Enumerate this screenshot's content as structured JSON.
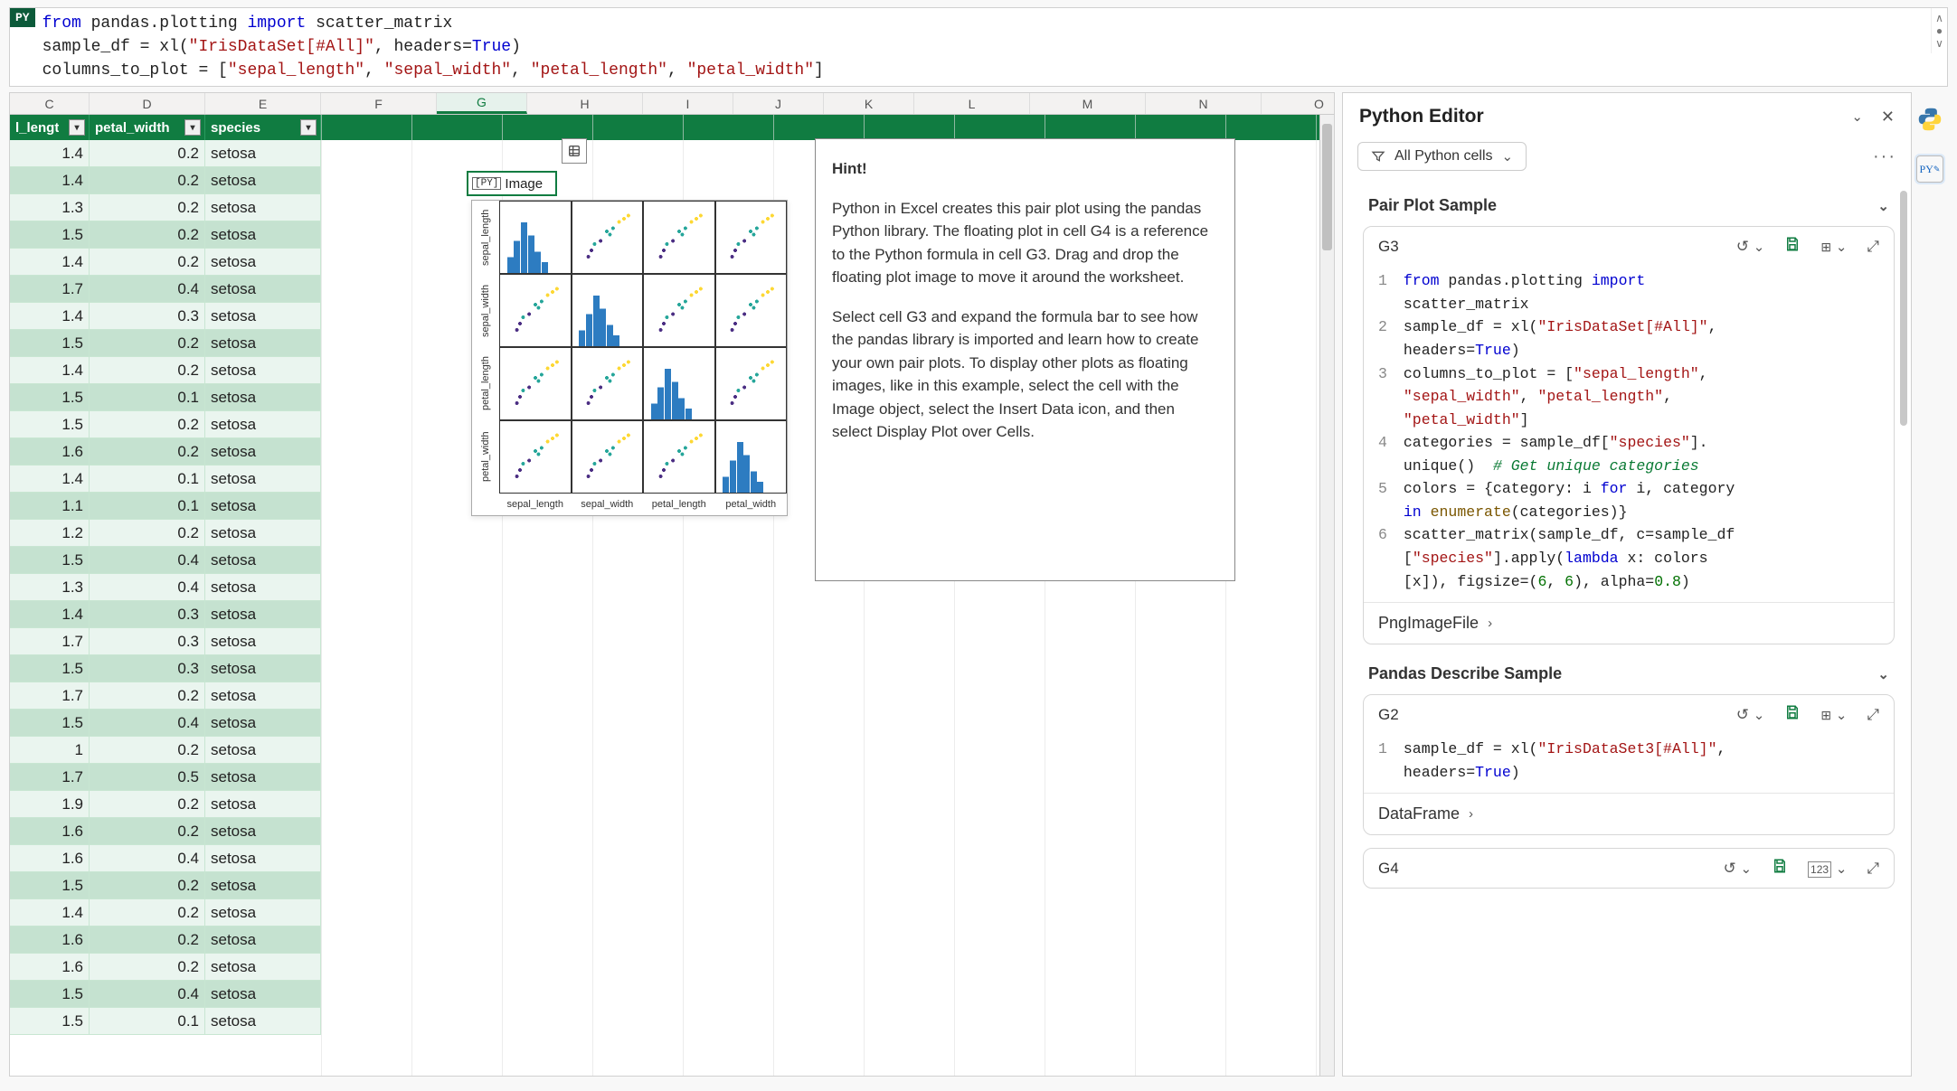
{
  "formula_bar": {
    "badge": "PY",
    "lines": [
      [
        {
          "t": "from ",
          "c": "kw-blue"
        },
        {
          "t": "pandas.plotting ",
          "c": ""
        },
        {
          "t": "import ",
          "c": "kw-blue"
        },
        {
          "t": "scatter_matrix",
          "c": ""
        }
      ],
      [
        {
          "t": "sample_df = xl(",
          "c": ""
        },
        {
          "t": "\"IrisDataSet[#All]\"",
          "c": "kw-str"
        },
        {
          "t": ", headers=",
          "c": ""
        },
        {
          "t": "True",
          "c": "kw-bool"
        },
        {
          "t": ")",
          "c": ""
        }
      ],
      [
        {
          "t": "columns_to_plot = [",
          "c": ""
        },
        {
          "t": "\"sepal_length\"",
          "c": "kw-str"
        },
        {
          "t": ", ",
          "c": ""
        },
        {
          "t": "\"sepal_width\"",
          "c": "kw-str"
        },
        {
          "t": ", ",
          "c": ""
        },
        {
          "t": "\"petal_length\"",
          "c": "kw-str"
        },
        {
          "t": ", ",
          "c": ""
        },
        {
          "t": "\"petal_width\"",
          "c": "kw-str"
        },
        {
          "t": "]",
          "c": ""
        }
      ]
    ]
  },
  "columns": [
    "C",
    "D",
    "E",
    "F",
    "G",
    "H",
    "I",
    "J",
    "K",
    "L",
    "M",
    "N",
    "O"
  ],
  "selected_col": "G",
  "filter_headers": [
    {
      "label": "l_lengt",
      "w": "fc-C"
    },
    {
      "label": "petal_width",
      "w": "fc-D"
    },
    {
      "label": "species",
      "w": "fc-E"
    }
  ],
  "rows": [
    {
      "c": "1.4",
      "d": "0.2",
      "e": "setosa"
    },
    {
      "c": "1.4",
      "d": "0.2",
      "e": "setosa"
    },
    {
      "c": "1.3",
      "d": "0.2",
      "e": "setosa"
    },
    {
      "c": "1.5",
      "d": "0.2",
      "e": "setosa"
    },
    {
      "c": "1.4",
      "d": "0.2",
      "e": "setosa"
    },
    {
      "c": "1.7",
      "d": "0.4",
      "e": "setosa"
    },
    {
      "c": "1.4",
      "d": "0.3",
      "e": "setosa"
    },
    {
      "c": "1.5",
      "d": "0.2",
      "e": "setosa"
    },
    {
      "c": "1.4",
      "d": "0.2",
      "e": "setosa"
    },
    {
      "c": "1.5",
      "d": "0.1",
      "e": "setosa"
    },
    {
      "c": "1.5",
      "d": "0.2",
      "e": "setosa"
    },
    {
      "c": "1.6",
      "d": "0.2",
      "e": "setosa"
    },
    {
      "c": "1.4",
      "d": "0.1",
      "e": "setosa"
    },
    {
      "c": "1.1",
      "d": "0.1",
      "e": "setosa"
    },
    {
      "c": "1.2",
      "d": "0.2",
      "e": "setosa"
    },
    {
      "c": "1.5",
      "d": "0.4",
      "e": "setosa"
    },
    {
      "c": "1.3",
      "d": "0.4",
      "e": "setosa"
    },
    {
      "c": "1.4",
      "d": "0.3",
      "e": "setosa"
    },
    {
      "c": "1.7",
      "d": "0.3",
      "e": "setosa"
    },
    {
      "c": "1.5",
      "d": "0.3",
      "e": "setosa"
    },
    {
      "c": "1.7",
      "d": "0.2",
      "e": "setosa"
    },
    {
      "c": "1.5",
      "d": "0.4",
      "e": "setosa"
    },
    {
      "c": "1",
      "d": "0.2",
      "e": "setosa"
    },
    {
      "c": "1.7",
      "d": "0.5",
      "e": "setosa"
    },
    {
      "c": "1.9",
      "d": "0.2",
      "e": "setosa"
    },
    {
      "c": "1.6",
      "d": "0.2",
      "e": "setosa"
    },
    {
      "c": "1.6",
      "d": "0.4",
      "e": "setosa"
    },
    {
      "c": "1.5",
      "d": "0.2",
      "e": "setosa"
    },
    {
      "c": "1.4",
      "d": "0.2",
      "e": "setosa"
    },
    {
      "c": "1.6",
      "d": "0.2",
      "e": "setosa"
    },
    {
      "c": "1.6",
      "d": "0.2",
      "e": "setosa"
    },
    {
      "c": "1.5",
      "d": "0.4",
      "e": "setosa"
    },
    {
      "c": "1.5",
      "d": "0.1",
      "e": "setosa"
    }
  ],
  "selected_cell": {
    "badge": "[PY]",
    "label": "Image"
  },
  "plot": {
    "labels": [
      "sepal_length",
      "sepal_width",
      "petal_length",
      "petal_width"
    ]
  },
  "hint": {
    "title": "Hint!",
    "p1": "Python in Excel creates this pair plot using the pandas Python library. The floating plot in cell G4 is a reference to the Python formula in cell G3. Drag and drop the floating plot image to move it around the worksheet.",
    "p2": "Select cell G3 and expand the formula bar to see how the pandas library is imported and learn how to create your own pair plots. To display other plots as floating images, like in this example, select the cell with the Image object, select the Insert Data icon, and then select Display Plot over Cells."
  },
  "editor": {
    "title": "Python Editor",
    "filter": "All Python cells",
    "sections": [
      {
        "title": "Pair Plot Sample",
        "cell": "G3",
        "foot": "PngImageFile",
        "lines": [
          [
            {
              "t": "from ",
              "c": "kw-blue"
            },
            {
              "t": "pandas.plotting ",
              "c": ""
            },
            {
              "t": "import",
              "c": "kw-blue"
            },
            {
              "t": "\nscatter_matrix",
              "c": ""
            }
          ],
          [
            {
              "t": "sample_df = xl(",
              "c": ""
            },
            {
              "t": "\"IrisDataSet[#All]\"",
              "c": "kw-str"
            },
            {
              "t": ",\nheaders=",
              "c": ""
            },
            {
              "t": "True",
              "c": "kw-bool"
            },
            {
              "t": ")",
              "c": ""
            }
          ],
          [
            {
              "t": "columns_to_plot = [",
              "c": ""
            },
            {
              "t": "\"sepal_length\"",
              "c": "kw-str"
            },
            {
              "t": ",\n",
              "c": ""
            },
            {
              "t": "\"sepal_width\"",
              "c": "kw-str"
            },
            {
              "t": ", ",
              "c": ""
            },
            {
              "t": "\"petal_length\"",
              "c": "kw-str"
            },
            {
              "t": ",\n",
              "c": ""
            },
            {
              "t": "\"petal_width\"",
              "c": "kw-str"
            },
            {
              "t": "]",
              "c": ""
            }
          ],
          [
            {
              "t": "categories = sample_df[",
              "c": ""
            },
            {
              "t": "\"species\"",
              "c": "kw-str"
            },
            {
              "t": "].\nunique()  ",
              "c": ""
            },
            {
              "t": "# Get unique categories",
              "c": "kw-comment"
            }
          ],
          [
            {
              "t": "colors = {category: i ",
              "c": ""
            },
            {
              "t": "for ",
              "c": "kw-blue"
            },
            {
              "t": "i, category\n",
              "c": ""
            },
            {
              "t": "in ",
              "c": "kw-blue"
            },
            {
              "t": "enumerate",
              "c": "kw-func"
            },
            {
              "t": "(categories)}",
              "c": ""
            }
          ],
          [
            {
              "t": "scatter_matrix(sample_df, c=sample_df\n[",
              "c": ""
            },
            {
              "t": "\"species\"",
              "c": "kw-str"
            },
            {
              "t": "].apply(",
              "c": ""
            },
            {
              "t": "lambda ",
              "c": "kw-blue"
            },
            {
              "t": "x: colors\n[x]), figsize=(",
              "c": ""
            },
            {
              "t": "6",
              "c": "kw-num"
            },
            {
              "t": ", ",
              "c": ""
            },
            {
              "t": "6",
              "c": "kw-num"
            },
            {
              "t": "), alpha=",
              "c": ""
            },
            {
              "t": "0.8",
              "c": "kw-num"
            },
            {
              "t": ")",
              "c": ""
            }
          ]
        ]
      },
      {
        "title": "Pandas Describe Sample",
        "cell": "G2",
        "foot": "DataFrame",
        "lines": [
          [
            {
              "t": "sample_df = xl(",
              "c": ""
            },
            {
              "t": "\"IrisDataSet3[#All]\"",
              "c": "kw-str"
            },
            {
              "t": ",\nheaders=",
              "c": ""
            },
            {
              "t": "True",
              "c": "kw-bool"
            },
            {
              "t": ")",
              "c": ""
            }
          ]
        ]
      },
      {
        "title": null,
        "cell": "G4",
        "foot": null,
        "lines": [],
        "mode_icon": "123"
      }
    ]
  }
}
